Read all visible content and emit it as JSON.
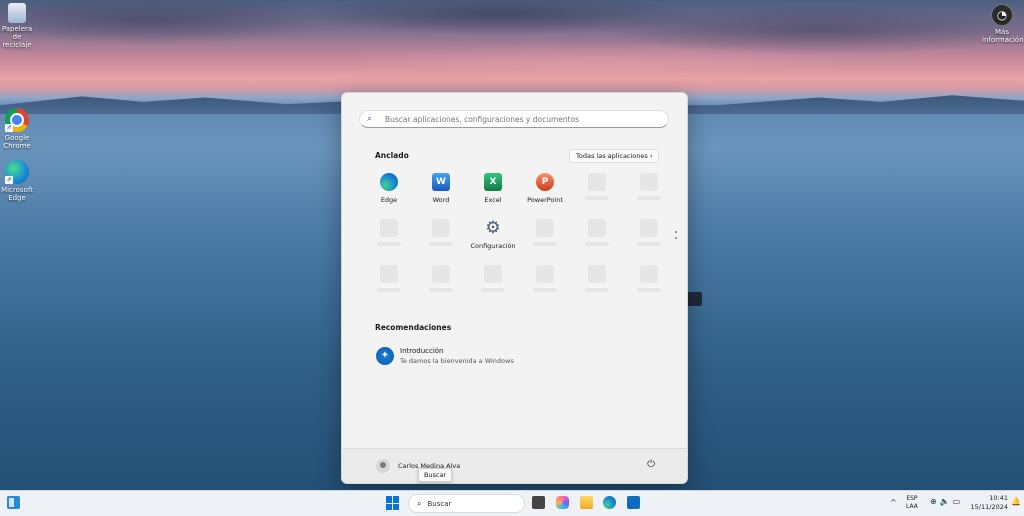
{
  "desktop": {
    "icons": [
      {
        "label": "Papelera de reciclaje"
      },
      {
        "label": "Google Chrome"
      },
      {
        "label": "Microsoft Edge"
      },
      {
        "label": "Más información..."
      }
    ]
  },
  "start_menu": {
    "search_placeholder": "Buscar aplicaciones, configuraciones y documentos",
    "pinned_title": "Anclado",
    "all_apps_label": "Todas las aplicaciones",
    "pinned_apps": [
      {
        "label": "Edge",
        "icon": "edge-icon"
      },
      {
        "label": "Word",
        "icon": "word-icon",
        "glyph": "W"
      },
      {
        "label": "Excel",
        "icon": "excel-icon",
        "glyph": "X"
      },
      {
        "label": "PowerPoint",
        "icon": "powerpoint-icon",
        "glyph": "P"
      },
      {
        "label": "Configuración",
        "icon": "gear-icon",
        "glyph": "⚙"
      }
    ],
    "recommended_title": "Recomendaciones",
    "recommended": [
      {
        "title": "Introducción",
        "subtitle": "Te damos la bienvenida a Windows"
      }
    ],
    "user_name": "Carlos Medina Alva"
  },
  "tooltip": "Buscar",
  "taskbar": {
    "search_label": "Buscar",
    "language_top": "ESP",
    "language_bottom": "LAA",
    "time": "10:41",
    "date": "15/11/2024"
  },
  "colors": {
    "accent": "#0a74da",
    "start_bg": "#f3f3f3",
    "taskbar_bg": "#eef1f6"
  }
}
